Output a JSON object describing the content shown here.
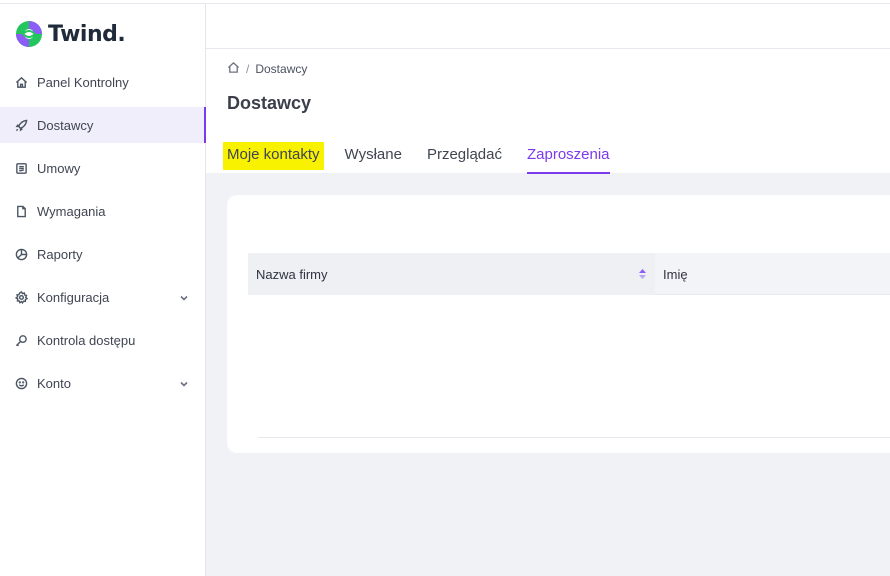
{
  "app": {
    "logo_text": "Twind.",
    "brand_color": "#7c3aed",
    "logo_colors": [
      "#22c55e",
      "#8b5cf6"
    ]
  },
  "sidebar": {
    "items": [
      {
        "label": "Panel Kontrolny",
        "icon": "home-icon"
      },
      {
        "label": "Dostawcy",
        "icon": "rocket-icon",
        "active": true
      },
      {
        "label": "Umowy",
        "icon": "contract-icon"
      },
      {
        "label": "Wymagania",
        "icon": "document-icon"
      },
      {
        "label": "Raporty",
        "icon": "pie-chart-icon"
      },
      {
        "label": "Konfiguracja",
        "icon": "gear-icon",
        "expandable": true
      },
      {
        "label": "Kontrola dostępu",
        "icon": "key-icon"
      },
      {
        "label": "Konto",
        "icon": "smiley-icon",
        "expandable": true
      }
    ]
  },
  "breadcrumb": {
    "home_icon": "home-icon",
    "separator": "/",
    "current": "Dostawcy"
  },
  "page": {
    "title": "Dostawcy"
  },
  "tabs": [
    {
      "label": "Moje kontakty",
      "highlighted": true
    },
    {
      "label": "Wysłane"
    },
    {
      "label": "Przeglądać"
    },
    {
      "label": "Zaproszenia",
      "active": true
    }
  ],
  "table": {
    "columns": [
      {
        "label": "Nazwa firmy",
        "sortable": true
      },
      {
        "label": "Imię"
      }
    ],
    "rows": []
  }
}
